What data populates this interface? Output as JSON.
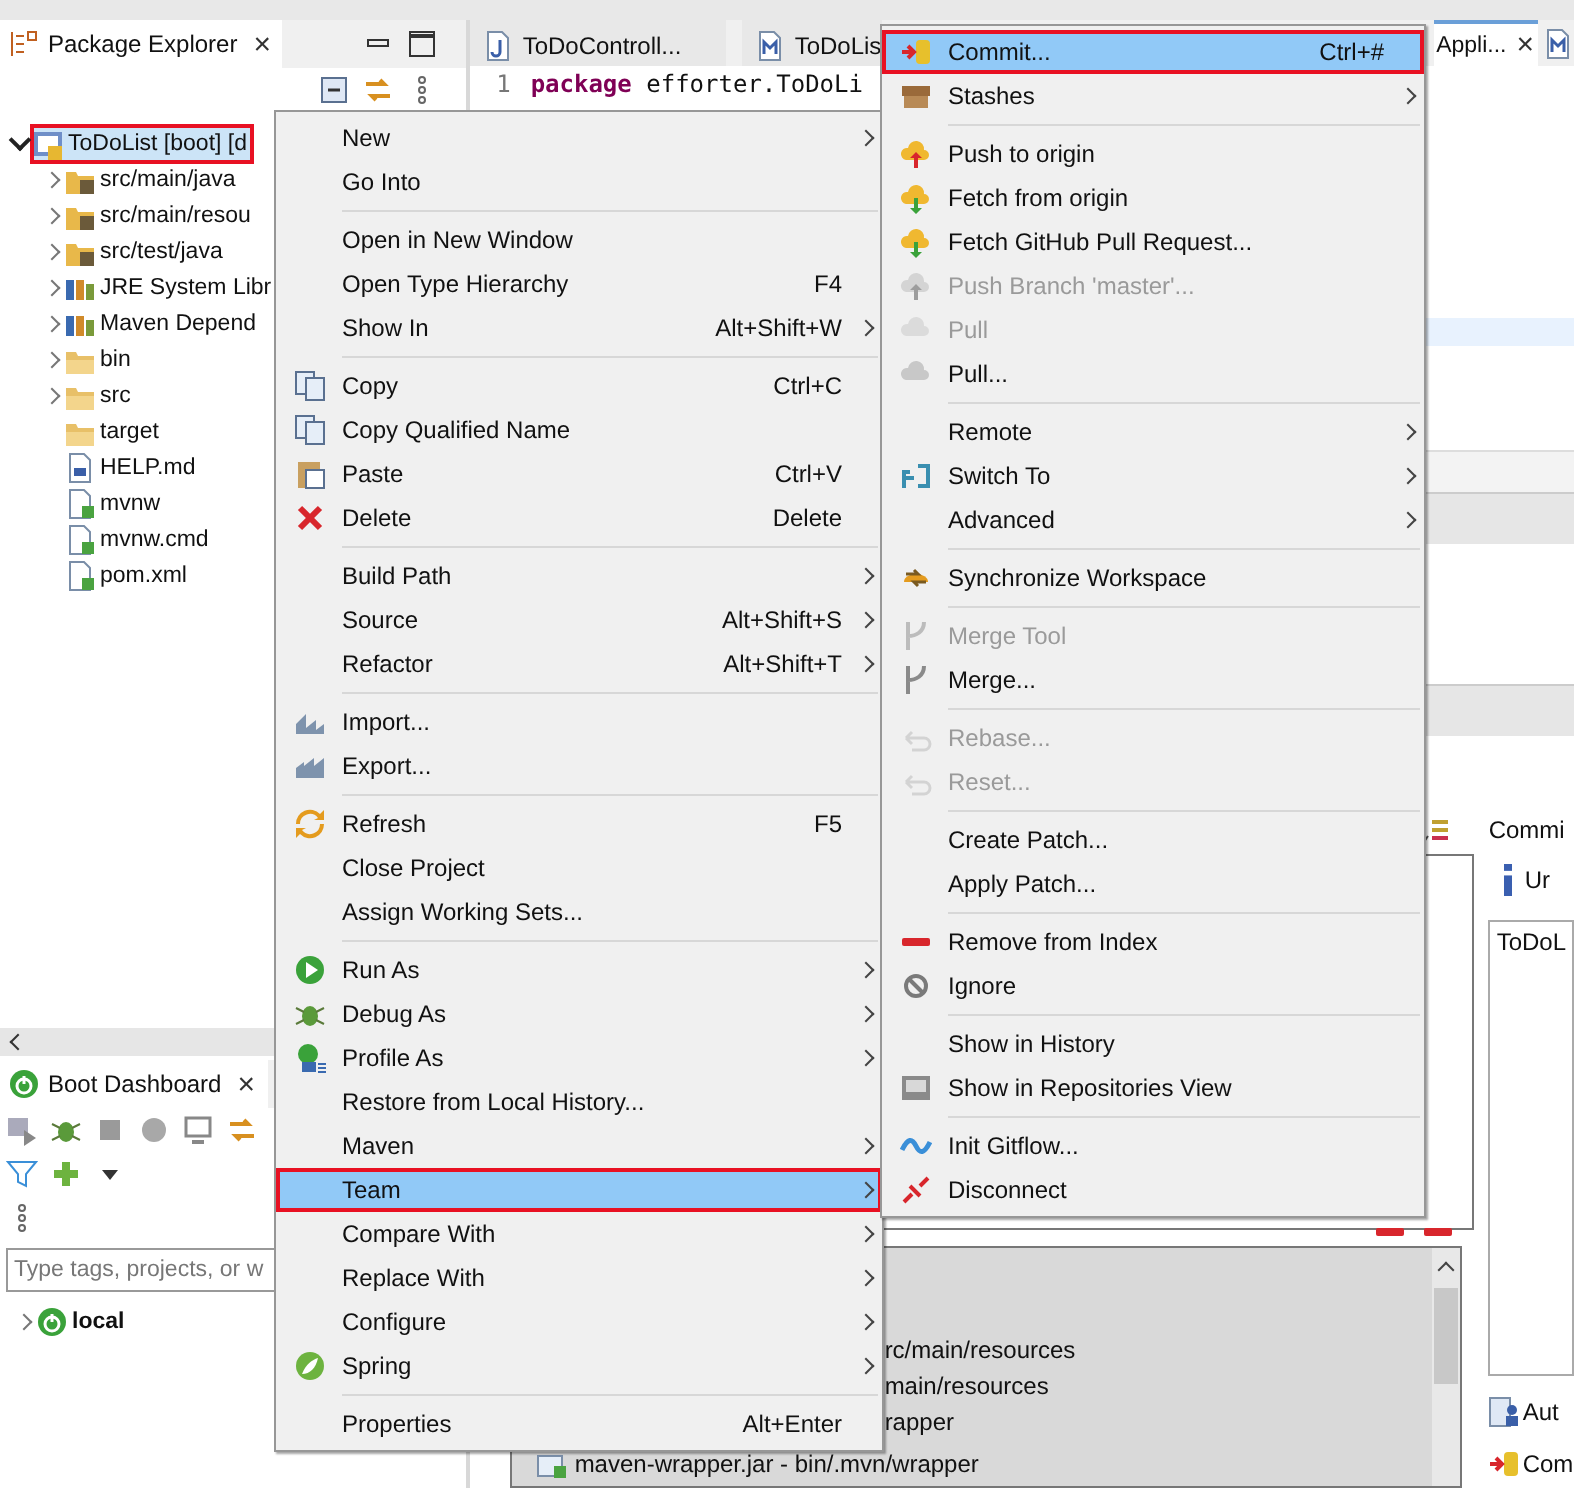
{
  "package_explorer": {
    "tab": {
      "title": "Package Explorer",
      "close": "×"
    },
    "tree": [
      {
        "label": "ToDoList [boot] [d",
        "expanded": true,
        "annotated": true,
        "children": [
          {
            "label": "src/main/java",
            "expanded": false
          },
          {
            "label": "src/main/resou",
            "expanded": false
          },
          {
            "label": "src/test/java",
            "expanded": false
          },
          {
            "label": "JRE System Libr",
            "expanded": false
          },
          {
            "label": "Maven Depend",
            "expanded": false
          },
          {
            "label": "bin",
            "expanded": false
          },
          {
            "label": "src",
            "expanded": false
          },
          {
            "label": "target"
          },
          {
            "label": "HELP.md"
          },
          {
            "label": "mvnw"
          },
          {
            "label": "mvnw.cmd"
          },
          {
            "label": "pom.xml"
          }
        ]
      }
    ]
  },
  "boot_dashboard": {
    "tab": {
      "title": "Boot Dashboard",
      "close": "×"
    },
    "filter": {
      "placeholder": "Type tags, projects, or w"
    },
    "tree": [
      {
        "label": "local",
        "expanded": false
      }
    ]
  },
  "editor": {
    "tabs": [
      {
        "label": "ToDoControll...",
        "selected": false
      },
      {
        "label": "ToDoLis",
        "selected": false
      },
      {
        "label": "Appli...",
        "selected": true,
        "close": "×"
      }
    ],
    "lines": [
      {
        "number": "1",
        "keyword": "package",
        "text": "efforter.ToDoLi"
      }
    ]
  },
  "staging": {
    "files": [
      {
        "text": "rc/main/resources"
      },
      {
        "text": "main/resources"
      },
      {
        "text": "rapper"
      },
      {
        "text": "maven-wrapper.jar - bin/.mvn/wrapper"
      }
    ],
    "commit_panel": {
      "title": "Commi",
      "info": "Ur",
      "message": "ToDoL",
      "author": "Aut",
      "committer": "Com"
    }
  },
  "context_menu": [
    {
      "kind": "item",
      "label": "New",
      "submenu": true,
      "disabled": false,
      "selected": false,
      "annotated": false
    },
    {
      "kind": "item",
      "label": "Go Into",
      "submenu": false,
      "disabled": false,
      "selected": false,
      "annotated": false
    },
    {
      "kind": "separator"
    },
    {
      "kind": "item",
      "label": "Open in New Window",
      "submenu": false,
      "disabled": false,
      "selected": false,
      "annotated": false
    },
    {
      "kind": "item",
      "label": "Open Type Hierarchy",
      "shortcut": "F4",
      "submenu": false,
      "disabled": false,
      "selected": false,
      "annotated": false
    },
    {
      "kind": "item",
      "label": "Show In",
      "shortcut": "Alt+Shift+W",
      "submenu": true,
      "disabled": false,
      "selected": false,
      "annotated": false
    },
    {
      "kind": "separator"
    },
    {
      "kind": "item",
      "label": "Copy",
      "shortcut": "Ctrl+C",
      "submenu": false,
      "disabled": false,
      "selected": false,
      "annotated": false
    },
    {
      "kind": "item",
      "label": "Copy Qualified Name",
      "submenu": false,
      "disabled": false,
      "selected": false,
      "annotated": false
    },
    {
      "kind": "item",
      "label": "Paste",
      "shortcut": "Ctrl+V",
      "submenu": false,
      "disabled": false,
      "selected": false,
      "annotated": false
    },
    {
      "kind": "item",
      "label": "Delete",
      "shortcut": "Delete",
      "submenu": false,
      "disabled": false,
      "selected": false,
      "annotated": false
    },
    {
      "kind": "separator"
    },
    {
      "kind": "item",
      "label": "Build Path",
      "submenu": true,
      "disabled": false,
      "selected": false,
      "annotated": false
    },
    {
      "kind": "item",
      "label": "Source",
      "shortcut": "Alt+Shift+S",
      "submenu": true,
      "disabled": false,
      "selected": false,
      "annotated": false
    },
    {
      "kind": "item",
      "label": "Refactor",
      "shortcut": "Alt+Shift+T",
      "submenu": true,
      "disabled": false,
      "selected": false,
      "annotated": false
    },
    {
      "kind": "separator"
    },
    {
      "kind": "item",
      "label": "Import...",
      "submenu": false,
      "disabled": false,
      "selected": false,
      "annotated": false
    },
    {
      "kind": "item",
      "label": "Export...",
      "submenu": false,
      "disabled": false,
      "selected": false,
      "annotated": false
    },
    {
      "kind": "separator"
    },
    {
      "kind": "item",
      "label": "Refresh",
      "shortcut": "F5",
      "submenu": false,
      "disabled": false,
      "selected": false,
      "annotated": false
    },
    {
      "kind": "item",
      "label": "Close Project",
      "submenu": false,
      "disabled": false,
      "selected": false,
      "annotated": false
    },
    {
      "kind": "item",
      "label": "Assign Working Sets...",
      "submenu": false,
      "disabled": false,
      "selected": false,
      "annotated": false
    },
    {
      "kind": "separator"
    },
    {
      "kind": "item",
      "label": "Run As",
      "submenu": true,
      "disabled": false,
      "selected": false,
      "annotated": false
    },
    {
      "kind": "item",
      "label": "Debug As",
      "submenu": true,
      "disabled": false,
      "selected": false,
      "annotated": false
    },
    {
      "kind": "item",
      "label": "Profile As",
      "submenu": true,
      "disabled": false,
      "selected": false,
      "annotated": false
    },
    {
      "kind": "item",
      "label": "Restore from Local History...",
      "submenu": false,
      "disabled": false,
      "selected": false,
      "annotated": false
    },
    {
      "kind": "item",
      "label": "Maven",
      "submenu": true,
      "disabled": false,
      "selected": false,
      "annotated": false
    },
    {
      "kind": "item",
      "label": "Team",
      "submenu": true,
      "disabled": false,
      "selected": true,
      "annotated": true
    },
    {
      "kind": "item",
      "label": "Compare With",
      "submenu": true,
      "disabled": false,
      "selected": false,
      "annotated": false
    },
    {
      "kind": "item",
      "label": "Replace With",
      "submenu": true,
      "disabled": false,
      "selected": false,
      "annotated": false
    },
    {
      "kind": "item",
      "label": "Configure",
      "submenu": true,
      "disabled": false,
      "selected": false,
      "annotated": false
    },
    {
      "kind": "item",
      "label": "Spring",
      "submenu": true,
      "disabled": false,
      "selected": false,
      "annotated": false
    },
    {
      "kind": "separator"
    },
    {
      "kind": "item",
      "label": "Properties",
      "shortcut": "Alt+Enter",
      "submenu": false,
      "disabled": false,
      "selected": false,
      "annotated": false
    }
  ],
  "team_submenu": [
    {
      "kind": "item",
      "label": "Commit...",
      "shortcut": "Ctrl+#",
      "submenu": false,
      "disabled": false,
      "selected": true,
      "annotated": true
    },
    {
      "kind": "item",
      "label": "Stashes",
      "submenu": true,
      "disabled": false,
      "selected": false,
      "annotated": false
    },
    {
      "kind": "separator"
    },
    {
      "kind": "item",
      "label": "Push to origin",
      "submenu": false,
      "disabled": false,
      "selected": false,
      "annotated": false
    },
    {
      "kind": "item",
      "label": "Fetch from origin",
      "submenu": false,
      "disabled": false,
      "selected": false,
      "annotated": false
    },
    {
      "kind": "item",
      "label": "Fetch GitHub Pull Request...",
      "submenu": false,
      "disabled": false,
      "selected": false,
      "annotated": false
    },
    {
      "kind": "item",
      "label": "Push Branch 'master'...",
      "submenu": false,
      "disabled": true,
      "selected": false,
      "annotated": false
    },
    {
      "kind": "item",
      "label": "Pull",
      "submenu": false,
      "disabled": true,
      "selected": false,
      "annotated": false
    },
    {
      "kind": "item",
      "label": "Pull...",
      "submenu": false,
      "disabled": false,
      "selected": false,
      "annotated": false
    },
    {
      "kind": "separator"
    },
    {
      "kind": "item",
      "label": "Remote",
      "submenu": true,
      "disabled": false,
      "selected": false,
      "annotated": false
    },
    {
      "kind": "item",
      "label": "Switch To",
      "submenu": true,
      "disabled": false,
      "selected": false,
      "annotated": false
    },
    {
      "kind": "item",
      "label": "Advanced",
      "submenu": true,
      "disabled": false,
      "selected": false,
      "annotated": false
    },
    {
      "kind": "separator"
    },
    {
      "kind": "item",
      "label": "Synchronize Workspace",
      "submenu": false,
      "disabled": false,
      "selected": false,
      "annotated": false
    },
    {
      "kind": "separator"
    },
    {
      "kind": "item",
      "label": "Merge Tool",
      "submenu": false,
      "disabled": true,
      "selected": false,
      "annotated": false
    },
    {
      "kind": "item",
      "label": "Merge...",
      "submenu": false,
      "disabled": false,
      "selected": false,
      "annotated": false
    },
    {
      "kind": "separator"
    },
    {
      "kind": "item",
      "label": "Rebase...",
      "submenu": false,
      "disabled": true,
      "selected": false,
      "annotated": false
    },
    {
      "kind": "item",
      "label": "Reset...",
      "submenu": false,
      "disabled": true,
      "selected": false,
      "annotated": false
    },
    {
      "kind": "separator"
    },
    {
      "kind": "item",
      "label": "Create Patch...",
      "submenu": false,
      "disabled": false,
      "selected": false,
      "annotated": false
    },
    {
      "kind": "item",
      "label": "Apply Patch...",
      "submenu": false,
      "disabled": false,
      "selected": false,
      "annotated": false
    },
    {
      "kind": "separator"
    },
    {
      "kind": "item",
      "label": "Remove from Index",
      "submenu": false,
      "disabled": false,
      "selected": false,
      "annotated": false
    },
    {
      "kind": "item",
      "label": "Ignore",
      "submenu": false,
      "disabled": false,
      "selected": false,
      "annotated": false
    },
    {
      "kind": "separator"
    },
    {
      "kind": "item",
      "label": "Show in History",
      "submenu": false,
      "disabled": false,
      "selected": false,
      "annotated": false
    },
    {
      "kind": "item",
      "label": "Show in Repositories View",
      "submenu": false,
      "disabled": false,
      "selected": false,
      "annotated": false
    },
    {
      "kind": "separator"
    },
    {
      "kind": "item",
      "label": "Init Gitflow...",
      "submenu": false,
      "disabled": false,
      "selected": false,
      "annotated": false
    },
    {
      "kind": "item",
      "label": "Disconnect",
      "submenu": false,
      "disabled": false,
      "selected": false,
      "annotated": false
    }
  ]
}
